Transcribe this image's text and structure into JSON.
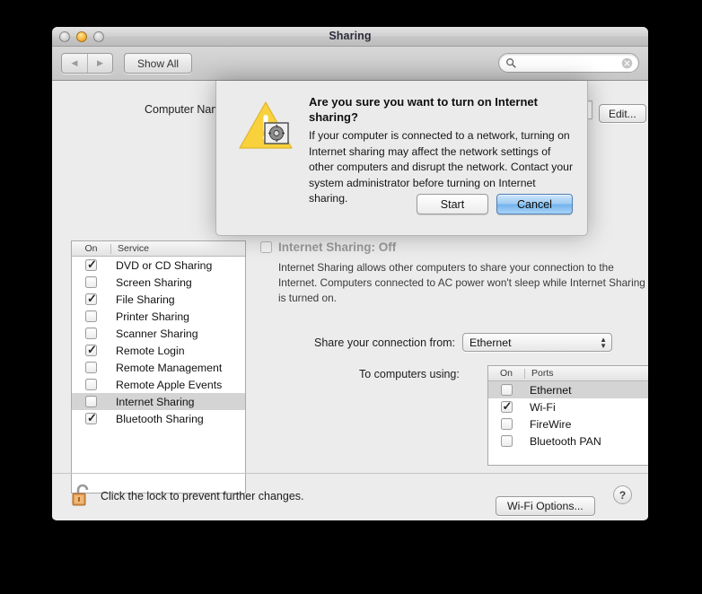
{
  "window": {
    "title": "Sharing",
    "traffic_lights": [
      "close",
      "minimize",
      "zoom"
    ]
  },
  "toolbar": {
    "back_label": "◀",
    "forward_label": "▶",
    "show_all_label": "Show All",
    "search_placeholder": "",
    "search_value": ""
  },
  "computer_name": {
    "label": "Computer Name:",
    "value": "",
    "edit_label": "Edit...",
    "hint": ""
  },
  "services": {
    "header_on": "On",
    "header_name": "Service",
    "items": [
      {
        "label": "DVD or CD Sharing",
        "checked": true,
        "selected": false
      },
      {
        "label": "Screen Sharing",
        "checked": false,
        "selected": false
      },
      {
        "label": "File Sharing",
        "checked": true,
        "selected": false
      },
      {
        "label": "Printer Sharing",
        "checked": false,
        "selected": false
      },
      {
        "label": "Scanner Sharing",
        "checked": false,
        "selected": false
      },
      {
        "label": "Remote Login",
        "checked": true,
        "selected": false
      },
      {
        "label": "Remote Management",
        "checked": false,
        "selected": false
      },
      {
        "label": "Remote Apple Events",
        "checked": false,
        "selected": false
      },
      {
        "label": "Internet Sharing",
        "checked": false,
        "selected": true
      },
      {
        "label": "Bluetooth Sharing",
        "checked": true,
        "selected": false
      }
    ]
  },
  "detail": {
    "status_title": "Internet Sharing: Off",
    "status_checked": false,
    "description": "Internet Sharing allows other computers to share your connection to the Internet. Computers connected to AC power won't sleep while Internet Sharing is turned on.",
    "share_from_label": "Share your connection from:",
    "share_from_value": "Ethernet",
    "to_computers_label": "To computers using:",
    "ports_header_on": "On",
    "ports_header_name": "Ports",
    "ports": [
      {
        "label": "Ethernet",
        "checked": false,
        "selected": true
      },
      {
        "label": "Wi-Fi",
        "checked": true,
        "selected": false
      },
      {
        "label": "FireWire",
        "checked": false,
        "selected": false
      },
      {
        "label": "Bluetooth PAN",
        "checked": false,
        "selected": false
      }
    ],
    "wifi_options_label": "Wi-Fi Options..."
  },
  "footer": {
    "lock_text": "Click the lock to prevent further changes.",
    "help_label": "?"
  },
  "dialog": {
    "title": "Are you sure you want to turn on Internet sharing?",
    "body": "If your computer is connected to a network, turning on Internet sharing may affect the network settings of other computers and disrupt the network. Contact your system administrator before turning on Internet sharing.",
    "start_label": "Start",
    "cancel_label": "Cancel",
    "default_button": "Cancel"
  },
  "colors": {
    "window_bg": "#ececec",
    "accent_blue": "#72b3ec",
    "warning_yellow": "#f8cf35",
    "selection_grey": "#d4d4d4"
  }
}
